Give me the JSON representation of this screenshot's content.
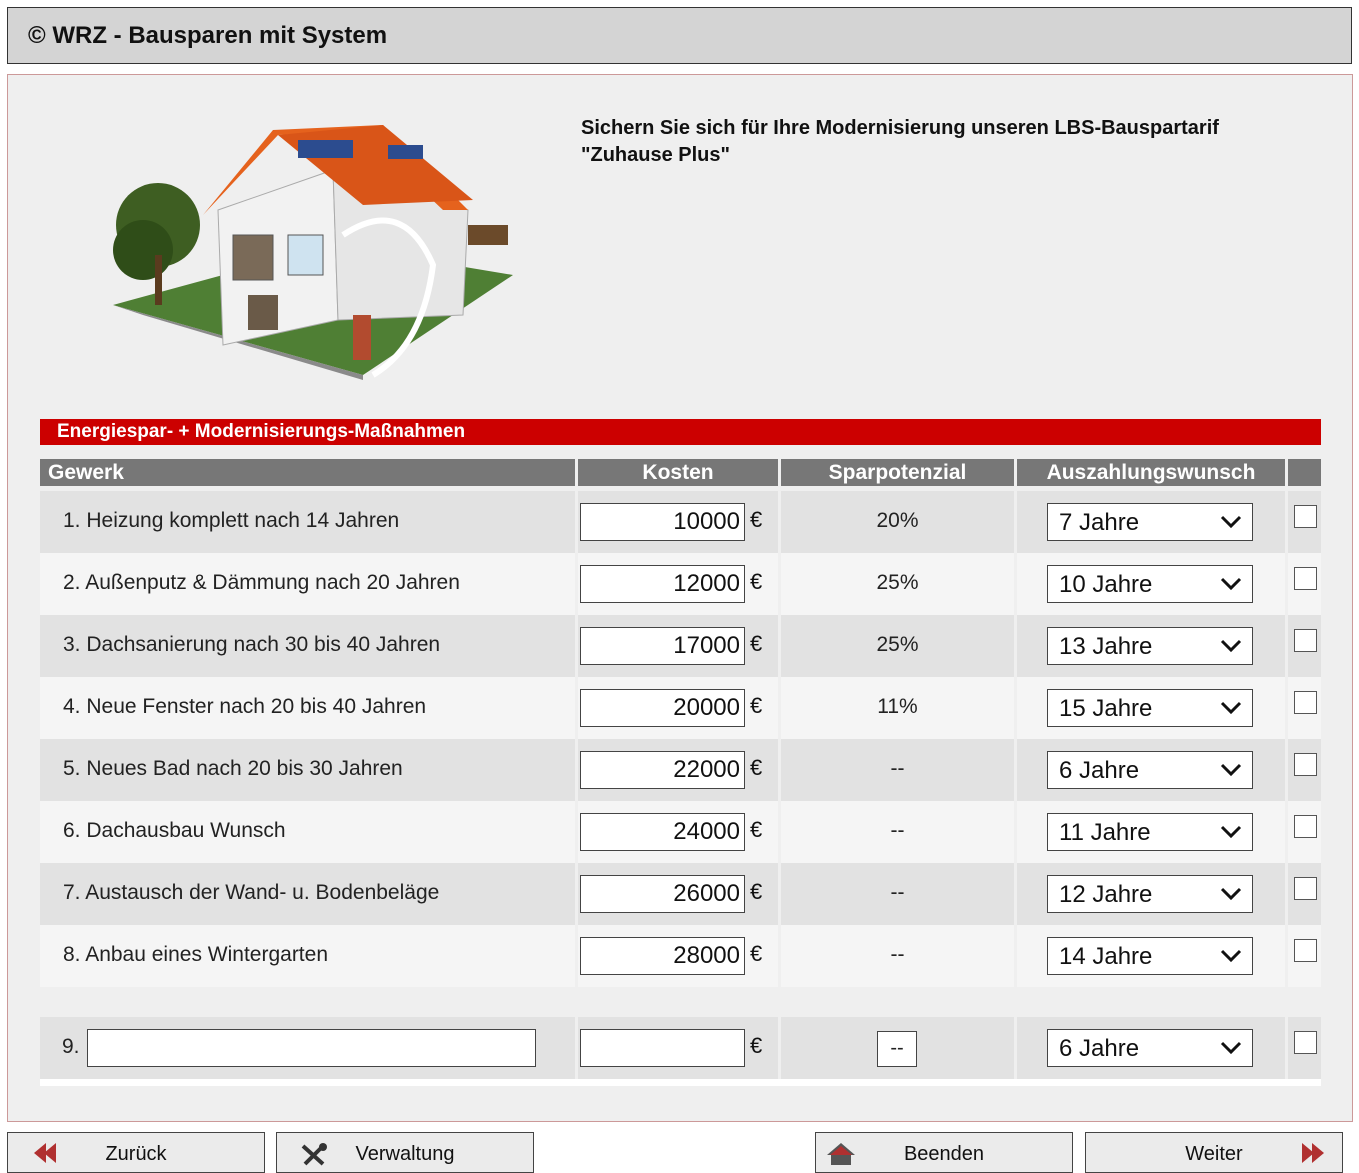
{
  "title": "© WRZ - Bausparen mit System",
  "headline": "Sichern Sie sich für Ihre Modernisierung unseren LBS-Bauspartarif \"Zuhause Plus\"",
  "section_title": "Energiespar- + Modernisierungs-Maßnahmen",
  "columns": {
    "gewerk": "Gewerk",
    "kosten": "Kosten",
    "sparpotenzial": "Sparpotenzial",
    "auszahlung": "Auszahlungswunsch"
  },
  "currency": "€",
  "rows": [
    {
      "label": "1. Heizung komplett nach 14 Jahren",
      "cost": "10000",
      "potential": "20%",
      "payout": "7 Jahre",
      "checked": false
    },
    {
      "label": "2. Außenputz & Dämmung nach 20 Jahren",
      "cost": "12000",
      "potential": "25%",
      "payout": "10 Jahre",
      "checked": false
    },
    {
      "label": "3. Dachsanierung nach 30 bis 40 Jahren",
      "cost": "17000",
      "potential": "25%",
      "payout": "13 Jahre",
      "checked": false
    },
    {
      "label": "4. Neue Fenster nach 20 bis 40 Jahren",
      "cost": "20000",
      "potential": "11%",
      "payout": "15 Jahre",
      "checked": false
    },
    {
      "label": "5. Neues Bad nach 20 bis 30 Jahren",
      "cost": "22000",
      "potential": "--",
      "payout": "6 Jahre",
      "checked": false
    },
    {
      "label": "6. Dachausbau Wunsch",
      "cost": "24000",
      "potential": "--",
      "payout": "11 Jahre",
      "checked": false
    },
    {
      "label": "7. Austausch der Wand- u. Bodenbeläge",
      "cost": "26000",
      "potential": "--",
      "payout": "12 Jahre",
      "checked": false
    },
    {
      "label": "8. Anbau eines Wintergarten",
      "cost": "28000",
      "potential": "--",
      "payout": "14 Jahre",
      "checked": false
    }
  ],
  "custom_row": {
    "number": "9.",
    "name_value": "",
    "cost": "",
    "potential": "--",
    "payout": "6 Jahre",
    "checked": false
  },
  "buttons": {
    "back": "Zurück",
    "admin": "Verwaltung",
    "quit": "Beenden",
    "next": "Weiter"
  },
  "colors": {
    "section_bar": "#cc0000",
    "header_bg": "#777777",
    "titlebar_bg": "#d4d4d4"
  },
  "icons": [
    "back-arrow-icon",
    "tools-icon",
    "home-icon",
    "forward-arrow-icon"
  ]
}
